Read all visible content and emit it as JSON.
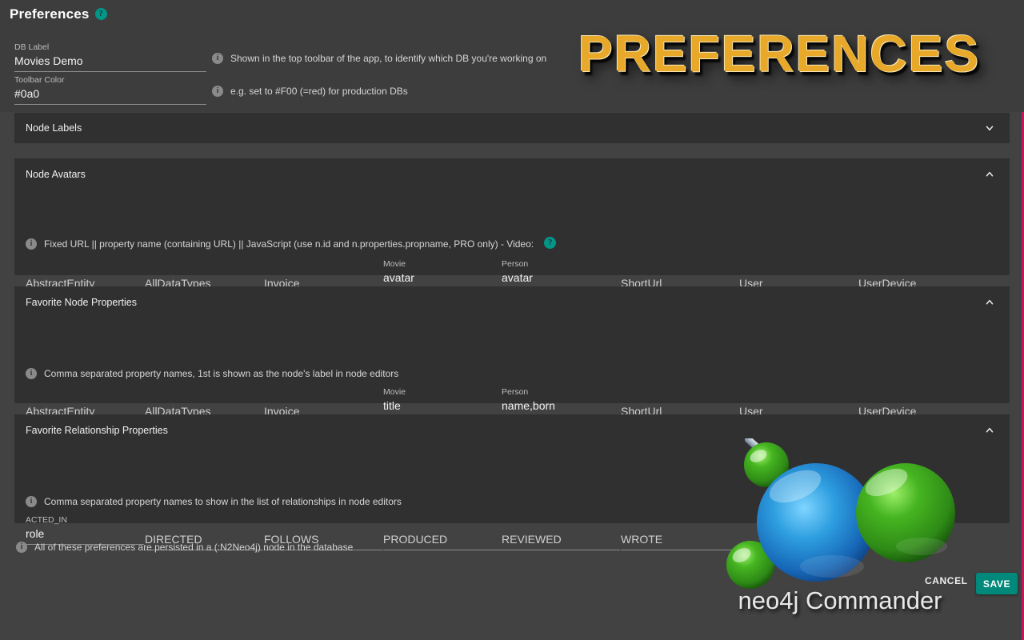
{
  "header": {
    "title": "Preferences",
    "help_icon": "question-mark-icon",
    "hero_title": "PREFERENCES",
    "hero_color": "#e8a92a",
    "db_label": {
      "label": "DB Label",
      "value": "Movies Demo",
      "hint": "Shown in the top toolbar of the app, to identify which DB you're working on"
    },
    "toolbar_color": {
      "label": "Toolbar Color",
      "value": "#0a0",
      "hint": "e.g. set to #F00 (=red) for production DBs"
    }
  },
  "panels": [
    {
      "title": "Node Labels",
      "expanded": false,
      "chevron": "chevron-down-icon"
    },
    {
      "title": "Node Avatars",
      "expanded": true,
      "chevron": "chevron-up-icon",
      "hint": "Fixed URL || property name (containing URL) || JavaScript (use n.id and n.properties.propname, PRO only) - Video:",
      "hint_help_icon": "question-mark-icon",
      "fields": [
        {
          "label": "",
          "placeholder": "AbstractEntity",
          "value": ""
        },
        {
          "label": "",
          "placeholder": "AllDataTypes",
          "value": ""
        },
        {
          "label": "",
          "placeholder": "Invoice",
          "value": ""
        },
        {
          "label": "Movie",
          "placeholder": "Movie",
          "value": "avatar"
        },
        {
          "label": "Person",
          "placeholder": "Person",
          "value": "avatar"
        },
        {
          "label": "",
          "placeholder": "ShortUrl",
          "value": ""
        },
        {
          "label": "",
          "placeholder": "User",
          "value": ""
        },
        {
          "label": "",
          "placeholder": "UserDevice",
          "value": ""
        }
      ]
    },
    {
      "title": "Favorite Node Properties",
      "expanded": true,
      "chevron": "chevron-up-icon",
      "hint": "Comma separated property names, 1st is shown as the node's label in node editors",
      "fields": [
        {
          "label": "",
          "placeholder": "AbstractEntity",
          "value": ""
        },
        {
          "label": "",
          "placeholder": "AllDataTypes",
          "value": ""
        },
        {
          "label": "",
          "placeholder": "Invoice",
          "value": ""
        },
        {
          "label": "Movie",
          "placeholder": "Movie",
          "value": "title"
        },
        {
          "label": "Person",
          "placeholder": "Person",
          "value": "name,born"
        },
        {
          "label": "",
          "placeholder": "ShortUrl",
          "value": ""
        },
        {
          "label": "",
          "placeholder": "User",
          "value": ""
        },
        {
          "label": "",
          "placeholder": "UserDevice",
          "value": ""
        }
      ]
    },
    {
      "title": "Favorite Relationship Properties",
      "expanded": true,
      "chevron": "chevron-up-icon",
      "hint": "Comma separated property names to show in the list of relationships in node editors",
      "fields": [
        {
          "label": "ACTED_IN",
          "placeholder": "ACTED_IN",
          "value": "role"
        },
        {
          "label": "",
          "placeholder": "DIRECTED",
          "value": ""
        },
        {
          "label": "",
          "placeholder": "FOLLOWS",
          "value": ""
        },
        {
          "label": "",
          "placeholder": "PRODUCED",
          "value": ""
        },
        {
          "label": "",
          "placeholder": "REVIEWED",
          "value": ""
        },
        {
          "label": "",
          "placeholder": "WROTE",
          "value": ""
        }
      ]
    }
  ],
  "footer": {
    "note": "All of these preferences are persisted in a (:N2Neo4j) node in the database",
    "cancel_label": "CANCEL",
    "save_label": "SAVE",
    "save_color": "#00897b"
  },
  "branding": {
    "product_name": "neo4j Commander",
    "logo_icon": "neo4j-graph-logo-icon"
  }
}
